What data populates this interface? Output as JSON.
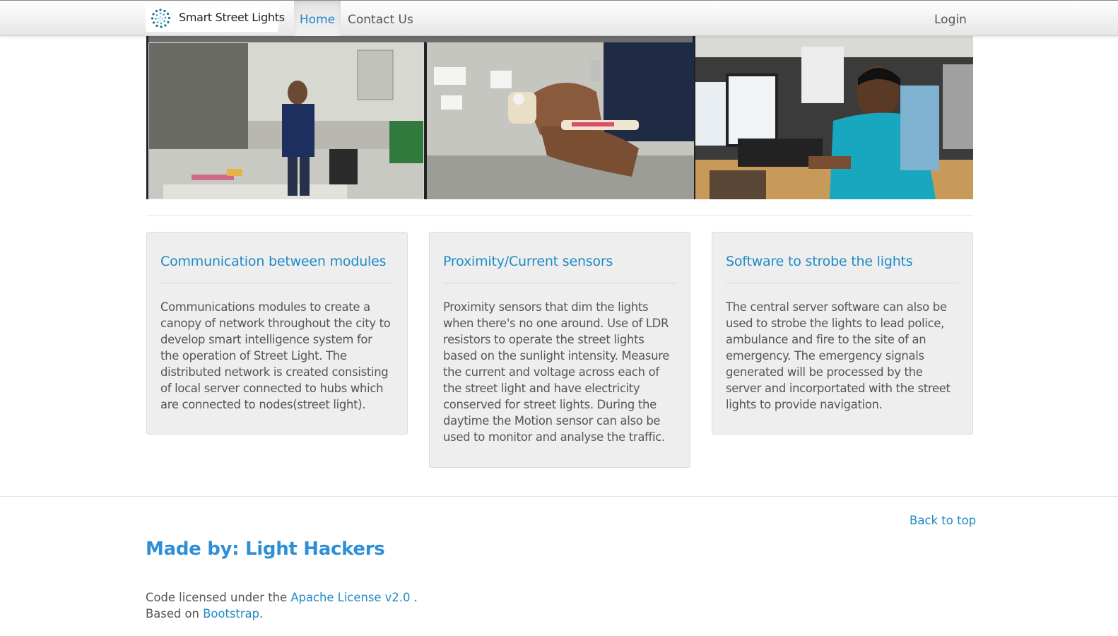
{
  "navbar": {
    "brand": "Smart Street Lights",
    "brand_icon": "dotted-circle-logo",
    "items": [
      {
        "label": "Home",
        "active": true
      },
      {
        "label": "Contact Us"
      }
    ],
    "login": "Login"
  },
  "features": [
    {
      "title": "Communication between modules",
      "text": "Communications modules to create a canopy of network throughout the city to develop smart intelligence system for the operation of Street Light. The distributed network is created consisting of local server connected to hubs which are connected to nodes(street light)."
    },
    {
      "title": "Proximity/Current sensors",
      "text": "Proximity sensors that dim the lights when there's no one around. Use of LDR resistors to operate the street lights based on the sunlight intensity. Measure the current and voltage across each of the street light and have electricity conserved for street lights. During the daytime the Motion sensor can also be used to monitor and analyse the traffic."
    },
    {
      "title": "Software to strobe the lights",
      "text": "The central server software can also be used to strobe the lights to lead police, ambulance and fire to the site of an emergency. The emergency signals generated will be processed by the server and incorportated with the street lights to provide navigation."
    }
  ],
  "footer": {
    "back_to_top": "Back to top",
    "made_by": "Made by: Light Hackers",
    "license_prefix": "Code licensed under the ",
    "license_link": "Apache License v2.0",
    "license_suffix": " .",
    "based_prefix": "Based on ",
    "based_link": "Bootstrap",
    "based_suffix": "."
  },
  "colors": {
    "accent": "#1e8ac6",
    "made_by": "#2f8fd6",
    "card_bg": "#eeeeee"
  }
}
